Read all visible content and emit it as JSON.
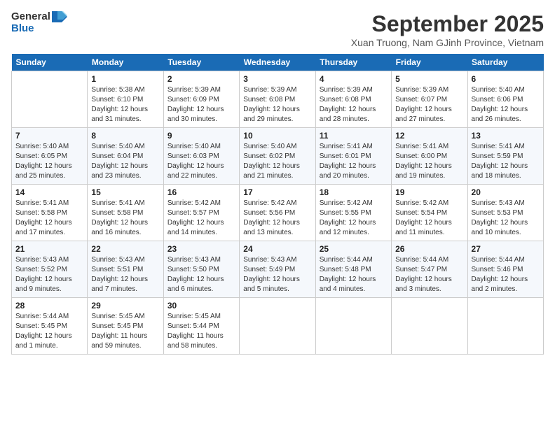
{
  "header": {
    "logo_line1": "General",
    "logo_line2": "Blue",
    "month_title": "September 2025",
    "subtitle": "Xuan Truong, Nam GJinh Province, Vietnam"
  },
  "weekdays": [
    "Sunday",
    "Monday",
    "Tuesday",
    "Wednesday",
    "Thursday",
    "Friday",
    "Saturday"
  ],
  "weeks": [
    [
      {
        "day": "",
        "info": ""
      },
      {
        "day": "1",
        "info": "Sunrise: 5:38 AM\nSunset: 6:10 PM\nDaylight: 12 hours\nand 31 minutes."
      },
      {
        "day": "2",
        "info": "Sunrise: 5:39 AM\nSunset: 6:09 PM\nDaylight: 12 hours\nand 30 minutes."
      },
      {
        "day": "3",
        "info": "Sunrise: 5:39 AM\nSunset: 6:08 PM\nDaylight: 12 hours\nand 29 minutes."
      },
      {
        "day": "4",
        "info": "Sunrise: 5:39 AM\nSunset: 6:08 PM\nDaylight: 12 hours\nand 28 minutes."
      },
      {
        "day": "5",
        "info": "Sunrise: 5:39 AM\nSunset: 6:07 PM\nDaylight: 12 hours\nand 27 minutes."
      },
      {
        "day": "6",
        "info": "Sunrise: 5:40 AM\nSunset: 6:06 PM\nDaylight: 12 hours\nand 26 minutes."
      }
    ],
    [
      {
        "day": "7",
        "info": "Sunrise: 5:40 AM\nSunset: 6:05 PM\nDaylight: 12 hours\nand 25 minutes."
      },
      {
        "day": "8",
        "info": "Sunrise: 5:40 AM\nSunset: 6:04 PM\nDaylight: 12 hours\nand 23 minutes."
      },
      {
        "day": "9",
        "info": "Sunrise: 5:40 AM\nSunset: 6:03 PM\nDaylight: 12 hours\nand 22 minutes."
      },
      {
        "day": "10",
        "info": "Sunrise: 5:40 AM\nSunset: 6:02 PM\nDaylight: 12 hours\nand 21 minutes."
      },
      {
        "day": "11",
        "info": "Sunrise: 5:41 AM\nSunset: 6:01 PM\nDaylight: 12 hours\nand 20 minutes."
      },
      {
        "day": "12",
        "info": "Sunrise: 5:41 AM\nSunset: 6:00 PM\nDaylight: 12 hours\nand 19 minutes."
      },
      {
        "day": "13",
        "info": "Sunrise: 5:41 AM\nSunset: 5:59 PM\nDaylight: 12 hours\nand 18 minutes."
      }
    ],
    [
      {
        "day": "14",
        "info": "Sunrise: 5:41 AM\nSunset: 5:58 PM\nDaylight: 12 hours\nand 17 minutes."
      },
      {
        "day": "15",
        "info": "Sunrise: 5:41 AM\nSunset: 5:58 PM\nDaylight: 12 hours\nand 16 minutes."
      },
      {
        "day": "16",
        "info": "Sunrise: 5:42 AM\nSunset: 5:57 PM\nDaylight: 12 hours\nand 14 minutes."
      },
      {
        "day": "17",
        "info": "Sunrise: 5:42 AM\nSunset: 5:56 PM\nDaylight: 12 hours\nand 13 minutes."
      },
      {
        "day": "18",
        "info": "Sunrise: 5:42 AM\nSunset: 5:55 PM\nDaylight: 12 hours\nand 12 minutes."
      },
      {
        "day": "19",
        "info": "Sunrise: 5:42 AM\nSunset: 5:54 PM\nDaylight: 12 hours\nand 11 minutes."
      },
      {
        "day": "20",
        "info": "Sunrise: 5:43 AM\nSunset: 5:53 PM\nDaylight: 12 hours\nand 10 minutes."
      }
    ],
    [
      {
        "day": "21",
        "info": "Sunrise: 5:43 AM\nSunset: 5:52 PM\nDaylight: 12 hours\nand 9 minutes."
      },
      {
        "day": "22",
        "info": "Sunrise: 5:43 AM\nSunset: 5:51 PM\nDaylight: 12 hours\nand 7 minutes."
      },
      {
        "day": "23",
        "info": "Sunrise: 5:43 AM\nSunset: 5:50 PM\nDaylight: 12 hours\nand 6 minutes."
      },
      {
        "day": "24",
        "info": "Sunrise: 5:43 AM\nSunset: 5:49 PM\nDaylight: 12 hours\nand 5 minutes."
      },
      {
        "day": "25",
        "info": "Sunrise: 5:44 AM\nSunset: 5:48 PM\nDaylight: 12 hours\nand 4 minutes."
      },
      {
        "day": "26",
        "info": "Sunrise: 5:44 AM\nSunset: 5:47 PM\nDaylight: 12 hours\nand 3 minutes."
      },
      {
        "day": "27",
        "info": "Sunrise: 5:44 AM\nSunset: 5:46 PM\nDaylight: 12 hours\nand 2 minutes."
      }
    ],
    [
      {
        "day": "28",
        "info": "Sunrise: 5:44 AM\nSunset: 5:45 PM\nDaylight: 12 hours\nand 1 minute."
      },
      {
        "day": "29",
        "info": "Sunrise: 5:45 AM\nSunset: 5:45 PM\nDaylight: 11 hours\nand 59 minutes."
      },
      {
        "day": "30",
        "info": "Sunrise: 5:45 AM\nSunset: 5:44 PM\nDaylight: 11 hours\nand 58 minutes."
      },
      {
        "day": "",
        "info": ""
      },
      {
        "day": "",
        "info": ""
      },
      {
        "day": "",
        "info": ""
      },
      {
        "day": "",
        "info": ""
      }
    ]
  ]
}
